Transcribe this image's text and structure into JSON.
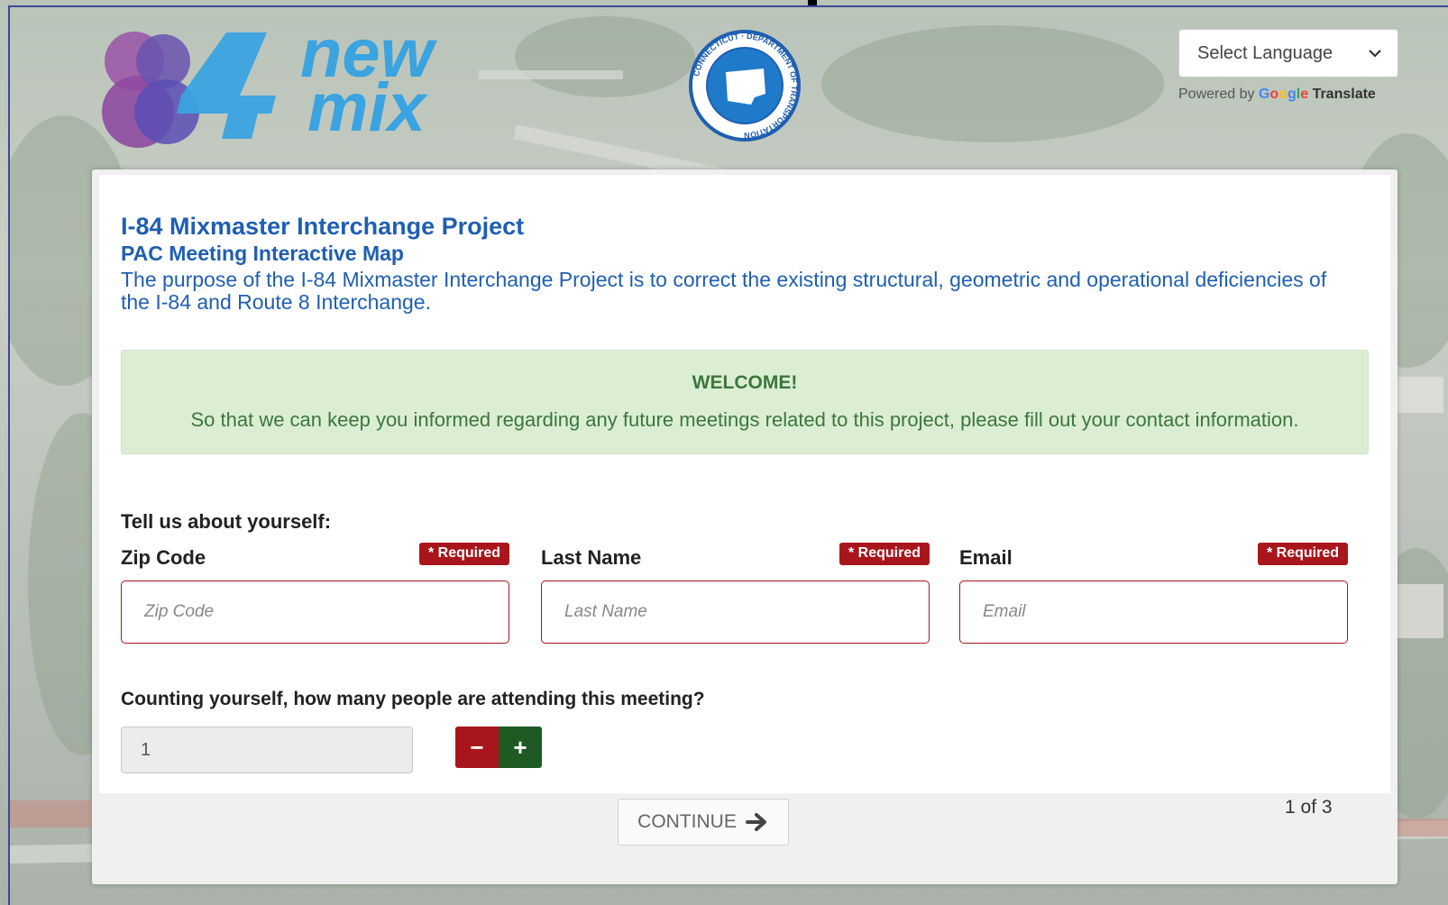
{
  "header": {
    "logo_line1": "new",
    "logo_line2": "mix",
    "logo_number": "84",
    "seal_text_top": "CONNECTICUT",
    "seal_text_ring": "DEPARTMENT OF TRANSPORTATION",
    "language_select": "Select Language",
    "powered_by": "Powered by",
    "google": "Google",
    "translate": "Translate"
  },
  "project": {
    "title": "I-84 Mixmaster Interchange Project",
    "subtitle": "PAC Meeting Interactive Map",
    "description": "The purpose of the I-84 Mixmaster Interchange Project is to correct the existing structural, geometric and operational deficiencies of the I-84 and Route 8 Interchange."
  },
  "welcome": {
    "heading": "WELCOME!",
    "text": "So that we can keep you informed regarding any future meetings related to this project, please fill out your contact information."
  },
  "form": {
    "section_label": "Tell us about yourself:",
    "fields": [
      {
        "label": "Zip Code",
        "required": "* Required",
        "placeholder": "Zip Code",
        "value": ""
      },
      {
        "label": "Last Name",
        "required": "* Required",
        "placeholder": "Last Name",
        "value": ""
      },
      {
        "label": "Email",
        "required": "* Required",
        "placeholder": "Email",
        "value": ""
      }
    ],
    "attendance_question": "Counting yourself, how many people are attending this meeting?",
    "attendance_value": "1",
    "minus_label": "−",
    "plus_label": "+"
  },
  "footer": {
    "continue_label": "CONTINUE",
    "pager": "1 of 3"
  },
  "colors": {
    "title_blue": "#1f5fb1",
    "required_red": "#a8161c",
    "plus_green": "#1f5a24",
    "welcome_bg": "#dbeed4",
    "welcome_text": "#3c763d"
  }
}
